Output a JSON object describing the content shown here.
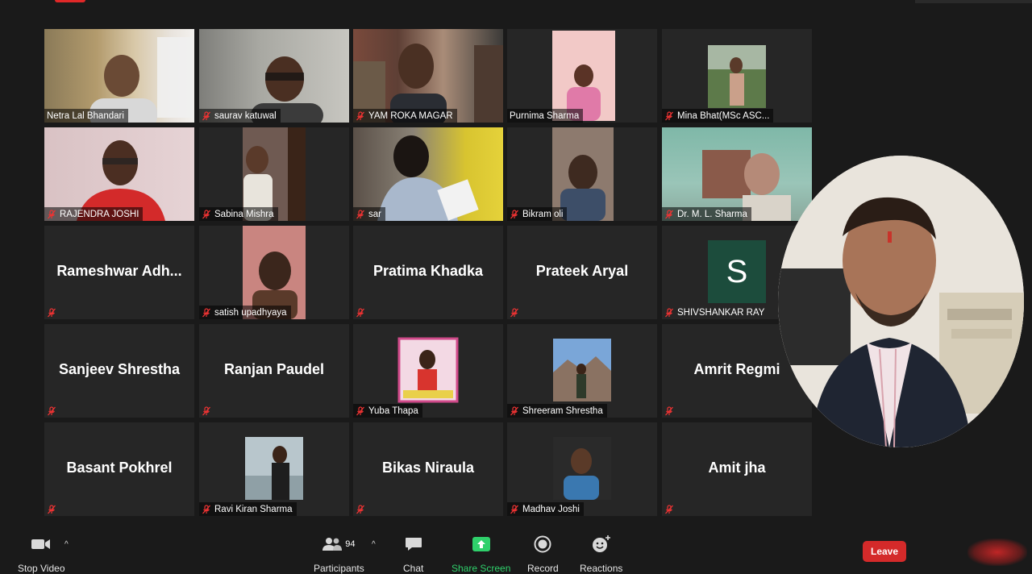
{
  "meeting": {
    "participants_count": "94",
    "leave_label": "Leave"
  },
  "toolbar": {
    "stop_video_label": "Stop Video",
    "participants_label": "Participants",
    "chat_label": "Chat",
    "share_screen_label": "Share Screen",
    "record_label": "Record",
    "reactions_label": "Reactions",
    "share_color": "#2fd06b"
  },
  "colors": {
    "active_speaker_border": "#c9e36a",
    "leave": "#d42a2a",
    "tile_bg": "#262626",
    "page_bg": "#1a1a1a"
  },
  "tiles": [
    {
      "name": "Netra Lal Bhandari",
      "kind": "video",
      "muted": false
    },
    {
      "name": "saurav katuwal",
      "kind": "video",
      "muted": true
    },
    {
      "name": "YAM ROKA MAGAR",
      "kind": "video",
      "muted": true
    },
    {
      "name": "Purnima Sharma",
      "kind": "video",
      "muted": false,
      "active": true
    },
    {
      "name": "Mina Bhat(MSc ASC...",
      "kind": "video",
      "muted": true
    },
    {
      "name": "RAJENDRA JOSHI",
      "kind": "video",
      "muted": true
    },
    {
      "name": "Sabina Mishra",
      "kind": "video",
      "muted": true
    },
    {
      "name": "sar",
      "kind": "video",
      "muted": true
    },
    {
      "name": "Bikram oli",
      "kind": "video",
      "muted": true
    },
    {
      "name": "Dr. M. L. Sharma",
      "kind": "video",
      "muted": true
    },
    {
      "name": "Rameshwar  Adh...",
      "kind": "text",
      "muted": true
    },
    {
      "name": "satish upadhyaya",
      "kind": "video",
      "muted": true
    },
    {
      "name": "Pratima Khadka",
      "kind": "text",
      "muted": true
    },
    {
      "name": "Prateek Aryal",
      "kind": "text",
      "muted": true
    },
    {
      "name": "SHIVSHANKAR RAY",
      "kind": "avatar",
      "initial": "S",
      "muted": true
    },
    {
      "name": "Sanjeev Shrestha",
      "kind": "text",
      "muted": true
    },
    {
      "name": "Ranjan Paudel",
      "kind": "text",
      "muted": true
    },
    {
      "name": "Yuba Thapa",
      "kind": "photo",
      "muted": true
    },
    {
      "name": "Shreeram Shrestha",
      "kind": "photo",
      "muted": true
    },
    {
      "name": "Amrit Regmi",
      "kind": "text",
      "muted": true
    },
    {
      "name": "Basant Pokhrel",
      "kind": "text",
      "muted": true
    },
    {
      "name": "Ravi Kiran Sharma",
      "kind": "photo",
      "muted": true
    },
    {
      "name": "Bikas Niraula",
      "kind": "text",
      "muted": true
    },
    {
      "name": "Madhav Joshi",
      "kind": "photo",
      "muted": true
    },
    {
      "name": "Amit jha",
      "kind": "text",
      "muted": true
    }
  ]
}
